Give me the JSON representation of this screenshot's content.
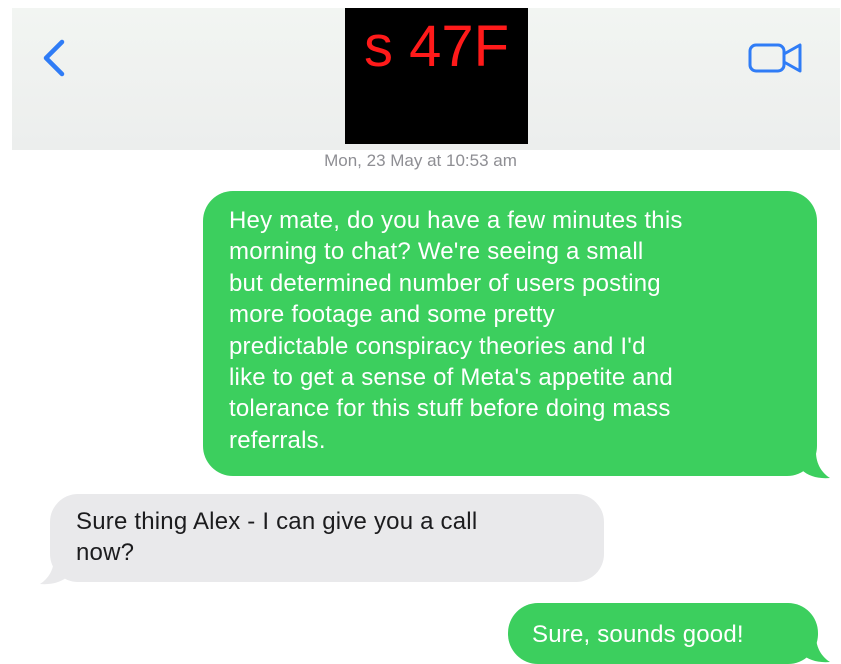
{
  "header": {
    "back_icon": "chevron-left-icon",
    "contact_name_redacted": "s 47F",
    "video_icon": "video-camera-icon",
    "accent_color": "#2f7cf6"
  },
  "conversation": {
    "timestamp": "Mon, 23 May at 10:53 am",
    "messages": [
      {
        "direction": "sent",
        "lines": [
          "Hey mate, do you have a few minutes this",
          "morning to chat? We're seeing a small",
          "but determined number of users posting",
          "more footage and some pretty",
          "predictable conspiracy theories and I'd",
          "like to get a sense of Meta's appetite and",
          "tolerance for this stuff before doing mass",
          "referrals."
        ]
      },
      {
        "direction": "received",
        "lines": [
          "Sure thing Alex - I can give you a call",
          "now?"
        ]
      },
      {
        "direction": "sent",
        "lines": [
          "Sure, sounds good!"
        ]
      }
    ]
  },
  "colors": {
    "sent_bubble": "#3ccf5e",
    "received_bubble": "#e9e9eb",
    "redaction_fill": "#000000",
    "redaction_text": "#ff1a1a"
  }
}
